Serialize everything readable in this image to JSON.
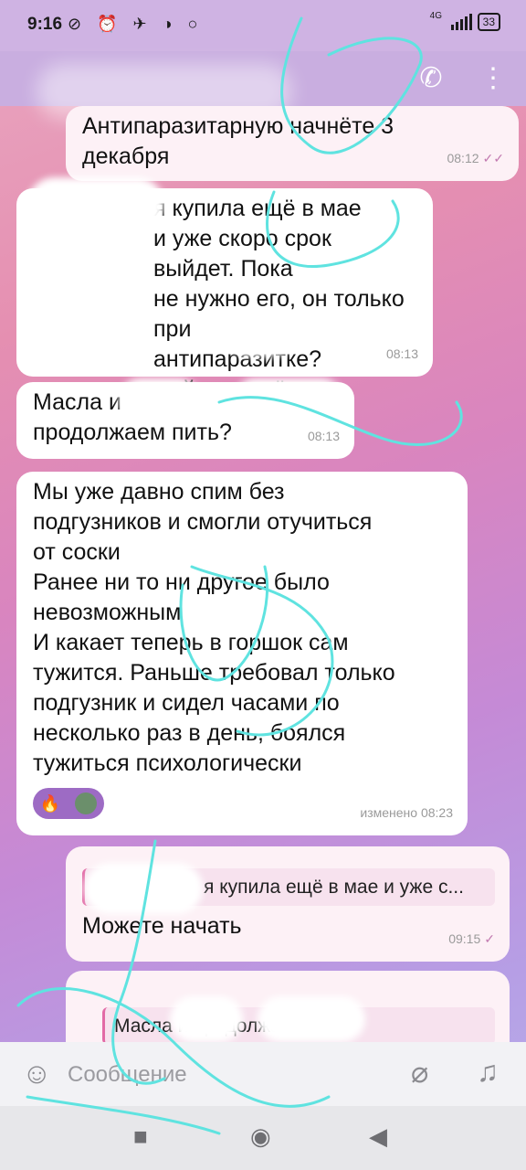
{
  "status_bar": {
    "time": "9:16",
    "network": "4G",
    "battery": "33"
  },
  "header": {
    "call_icon": "phone-icon",
    "menu_icon": "more-vertical-icon"
  },
  "messages": [
    {
      "direction": "out",
      "text": "Антипаразитарную начнёте 3\nдекабря",
      "time": "08:12",
      "status": "✓✓"
    },
    {
      "direction": "in",
      "text": "я купила ещё в мае\nи уже скоро срок выйдет. Пока\nне нужно его, он только при\nантипаразитке?\nный сок ещё пьем",
      "time": "08:13"
    },
    {
      "direction": "in",
      "text": "Масла и\nпродолжаем пить?",
      "time": "08:13"
    },
    {
      "direction": "in",
      "text": "Мы уже давно спим без\nподгузников и смогли отучиться\nот соски\nРанее ни то ни другое было\nневозможным\nИ какает теперь в горшок сам\nтужится. Раньше требовал только\nподгузник и сидел часами по\nнесколько раз в день, боялся\nтужиться психологически",
      "time": "изменено 08:23",
      "reaction": "🔥"
    },
    {
      "direction": "out",
      "reply_to": "я купила ещё в мае и уже с...",
      "text": "Можете начать",
      "time": "09:15",
      "status": "✓"
    },
    {
      "direction": "out",
      "reply_to": "Масла и продолжае..."
    }
  ],
  "input": {
    "placeholder": "Сообщение"
  },
  "colors": {
    "accent": "#9d6bc4",
    "header": "#c9aee0",
    "scribble": "#5fe3e0"
  }
}
